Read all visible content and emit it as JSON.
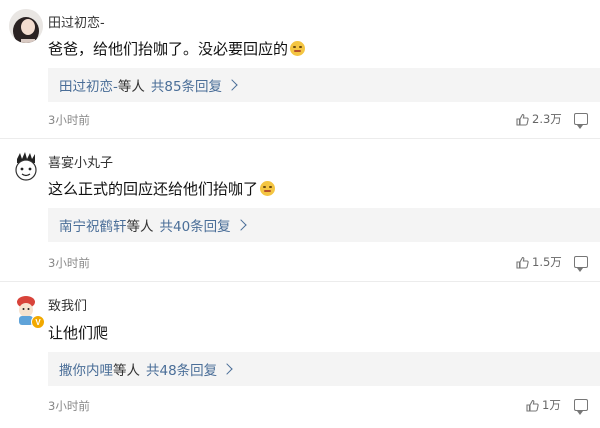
{
  "comments": [
    {
      "username": "田过初恋-",
      "content": "爸爸，给他们抬咖了。没必要回应的",
      "emoji": "grimace-emoji",
      "reply_names": "田过初恋-",
      "reply_etc": "等人",
      "reply_count": "共85条回复",
      "time": "3小时前",
      "likes": "2.3万"
    },
    {
      "username": "喜宴小丸子",
      "content": "这么正式的回应还给他们抬咖了",
      "emoji": "sweat-emoji",
      "reply_names": "南宁祝鹤轩",
      "reply_etc": "等人",
      "reply_count": "共40条回复",
      "time": "3小时前",
      "likes": "1.5万"
    },
    {
      "username": "致我们",
      "content": "让他们爬",
      "reply_names": "撒你内哩",
      "reply_etc": "等人",
      "reply_count": "共48条回复",
      "time": "3小时前",
      "likes": "1万"
    }
  ],
  "colors": {
    "link": "#4a6e98",
    "reply_bg": "#f4f4f4",
    "divider": "#ececec"
  },
  "badge_v": "V"
}
